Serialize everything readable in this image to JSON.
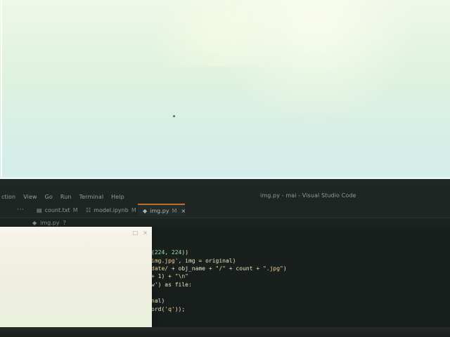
{
  "window": {
    "title": "img.py - mai - Visual Studio Code"
  },
  "menu": {
    "items": [
      "ction",
      "View",
      "Go",
      "Run",
      "Terminal",
      "Help"
    ]
  },
  "tabs": [
    {
      "label": "count.txt",
      "status": "M",
      "icon": "text-file-icon"
    },
    {
      "label": "model.ipynb",
      "status": "M",
      "icon": "notebook-icon"
    },
    {
      "label": "img.py",
      "status": "M",
      "icon": "python-icon",
      "active": true
    }
  ],
  "breadcrumb": {
    "file": "img.py",
    "suffix": "?"
  },
  "code": {
    "line1_num_a": "224",
    "line1_num_b": "224",
    "line2_prefix": "img.jpg'",
    "line2_mid": ", img = original)",
    "line3_a": "date/",
    "line3_b": " + obj_name + ",
    "line3_c": "\"/\"",
    "line3_d": " + count + ",
    "line3_e": "\".jpg\"",
    "line3_f": ")",
    "line4_a": "+ 1) + ",
    "line4_b": "\"\\n\"",
    "line5_a": "w') as file:",
    "line6_a": "nal)",
    "line7_a": "ord(",
    "line7_b": "'q'",
    "line7_c": "));"
  },
  "overlay": {
    "min_icon": "minimize-icon",
    "close_icon": "close-icon"
  }
}
